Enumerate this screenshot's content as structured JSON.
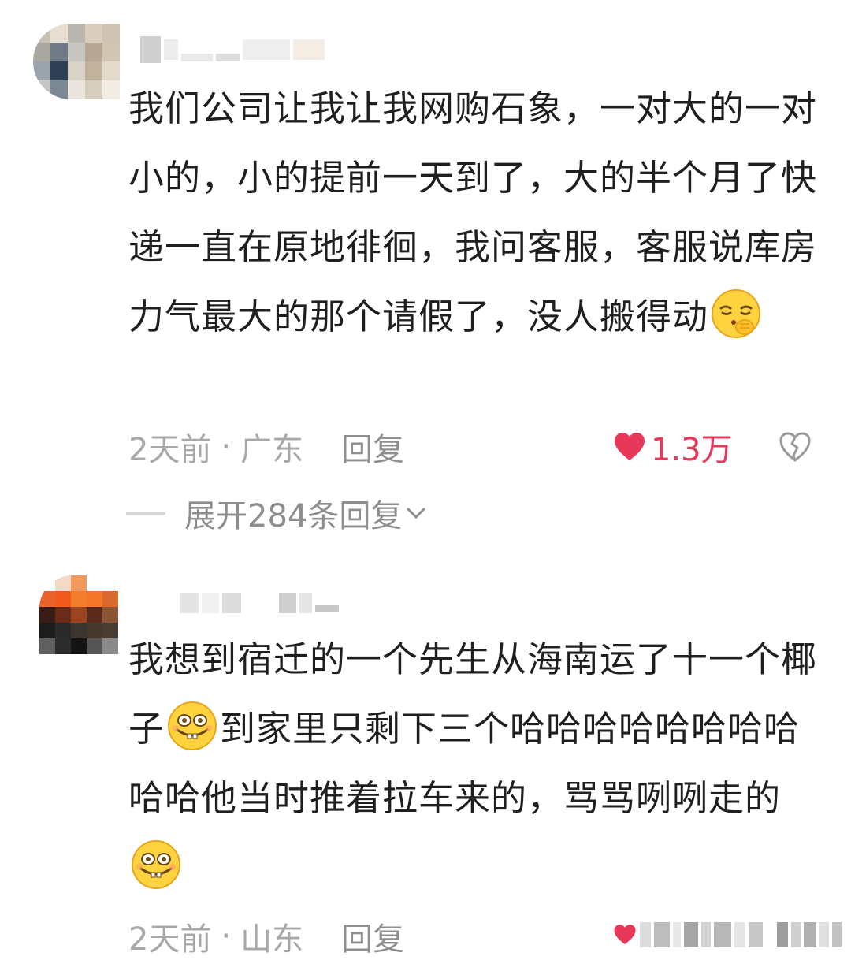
{
  "comments": [
    {
      "text_before_emoji": "我们公司让我让我网购石象，一对大的一对小的，小的提前一天到了，大的半个月了快递一直在原地徘徊，我问客服，客服说库房力气最大的那个请假了，没人搬得动",
      "emoji_1": "hush-emoji",
      "time": "2天前",
      "separator": "·",
      "location": "广东",
      "reply_label": "回复",
      "like_count": "1.3万",
      "expand_label": "展开284条回复"
    },
    {
      "text_part_1": "我想到宿迁的一个先生从海南运了十一个椰子",
      "text_part_2": "到家里只剩下三个哈哈哈哈哈哈哈哈哈哈他当时推着拉车来的，骂骂咧咧走的",
      "emoji_1": "grin-emoji",
      "emoji_2": "grin-emoji",
      "time": "2天前",
      "separator": "·",
      "location": "山东",
      "reply_label": "回复"
    }
  ],
  "colors": {
    "like_red": "#e8385a",
    "meta_gray": "#a8a8a8",
    "text": "#1f1f1f"
  }
}
